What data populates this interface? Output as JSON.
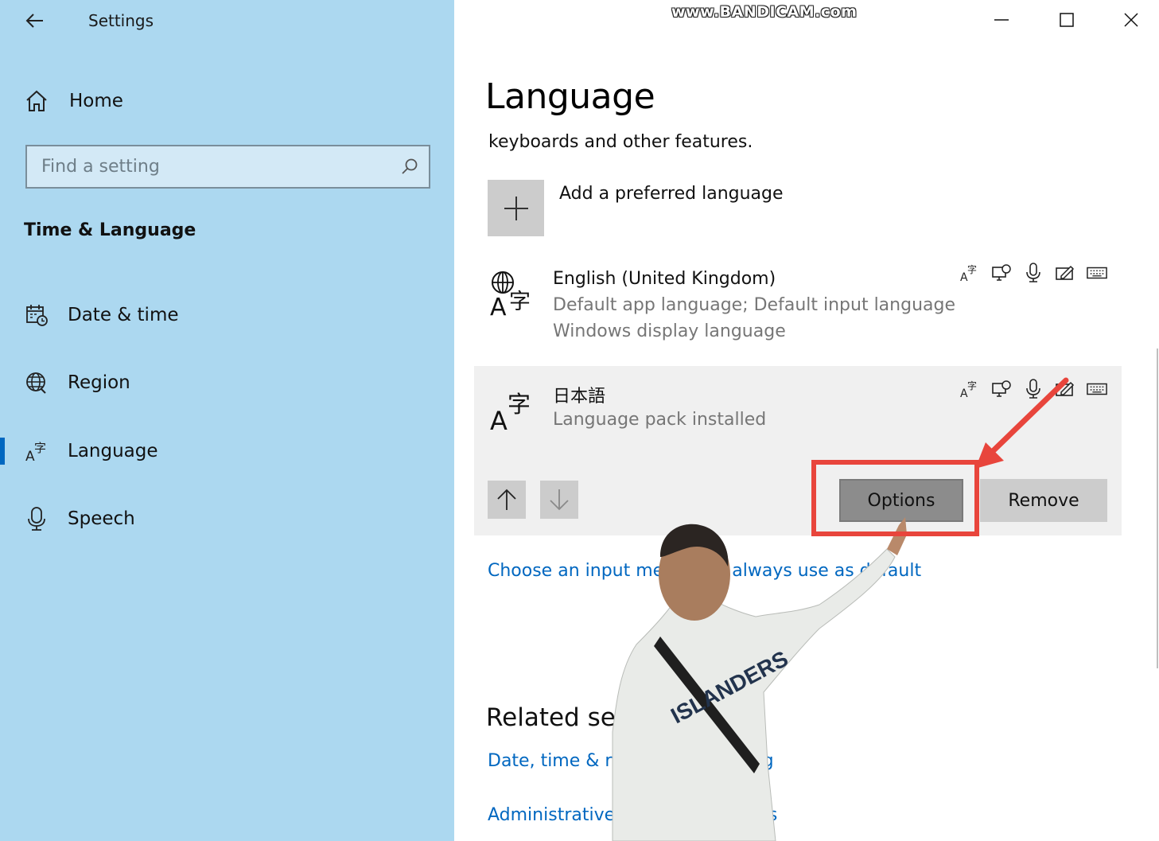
{
  "window": {
    "title": "Settings",
    "watermark": "www.BANDICAM.com"
  },
  "sidebar": {
    "home_label": "Home",
    "search_placeholder": "Find a setting",
    "section_title": "Time & Language",
    "items": [
      {
        "label": "Date & time",
        "icon": "calendar-clock-icon"
      },
      {
        "label": "Region",
        "icon": "globe-icon"
      },
      {
        "label": "Language",
        "icon": "language-icon",
        "selected": true
      },
      {
        "label": "Speech",
        "icon": "microphone-icon"
      }
    ]
  },
  "main": {
    "title": "Language",
    "description": "keyboards and other features.",
    "add_language_label": "Add a preferred language",
    "languages": [
      {
        "name": "English (United Kingdom)",
        "details": [
          "Default app language; Default input language",
          "Windows display language"
        ]
      },
      {
        "name": "日本語",
        "details": [
          "Language pack installed"
        ],
        "selected": true
      }
    ],
    "options_label": "Options",
    "remove_label": "Remove",
    "input_method_link": "Choose an input method to always use as default",
    "related_title": "Related settings",
    "related_links": [
      "Date, time & regional formatting",
      "Administrative language settings"
    ]
  },
  "colors": {
    "sidebar_bg": "#acd8f0",
    "link": "#0067c0",
    "selected_row_bg": "#f0f0f0",
    "annotation_red": "#e8453c"
  }
}
